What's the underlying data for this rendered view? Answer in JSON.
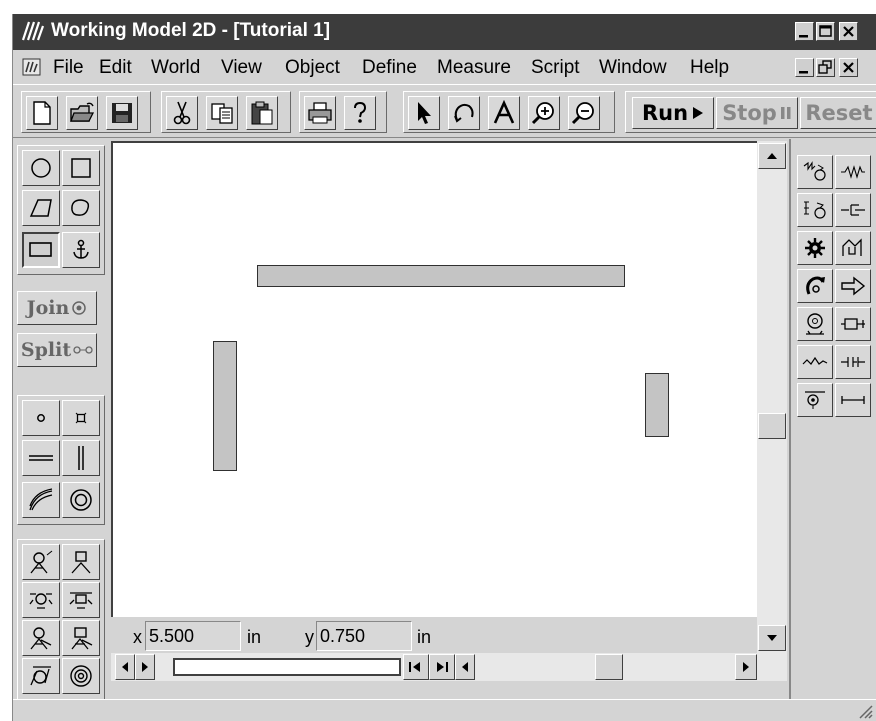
{
  "window": {
    "title": "Working Model 2D - [Tutorial 1]",
    "caption_buttons": [
      "_",
      "□",
      "×"
    ]
  },
  "menu": {
    "items": [
      "File",
      "Edit",
      "World",
      "View",
      "Object",
      "Define",
      "Measure",
      "Script",
      "Window",
      "Help"
    ],
    "mdi_buttons": [
      "_",
      "🗗",
      "×"
    ]
  },
  "toolbar": {
    "file_icons": [
      "new-document-icon",
      "open-folder-icon",
      "save-disk-icon"
    ],
    "edit_icons": [
      "cut-scissors-icon",
      "copy-icon",
      "paste-clipboard-icon"
    ],
    "misc_icons": [
      "print-icon",
      "help-question-icon"
    ],
    "tool_icons": [
      "arrow-pointer-icon",
      "rotate-icon",
      "text-icon",
      "zoom-in-icon",
      "zoom-out-icon"
    ],
    "run_label": "Run",
    "stop_label": "Stop",
    "reset_label": "Reset"
  },
  "left_tools": {
    "join_label": "Join",
    "split_label": "Split"
  },
  "coords": {
    "x_label": "x",
    "x_value": "5.500",
    "x_unit": "in",
    "y_label": "y",
    "y_value": "0.750",
    "y_unit": "in"
  },
  "colors": {
    "titlebar": "#3c3c3c",
    "body_fill": "#c4c4c4",
    "face": "#d4d4d4"
  }
}
